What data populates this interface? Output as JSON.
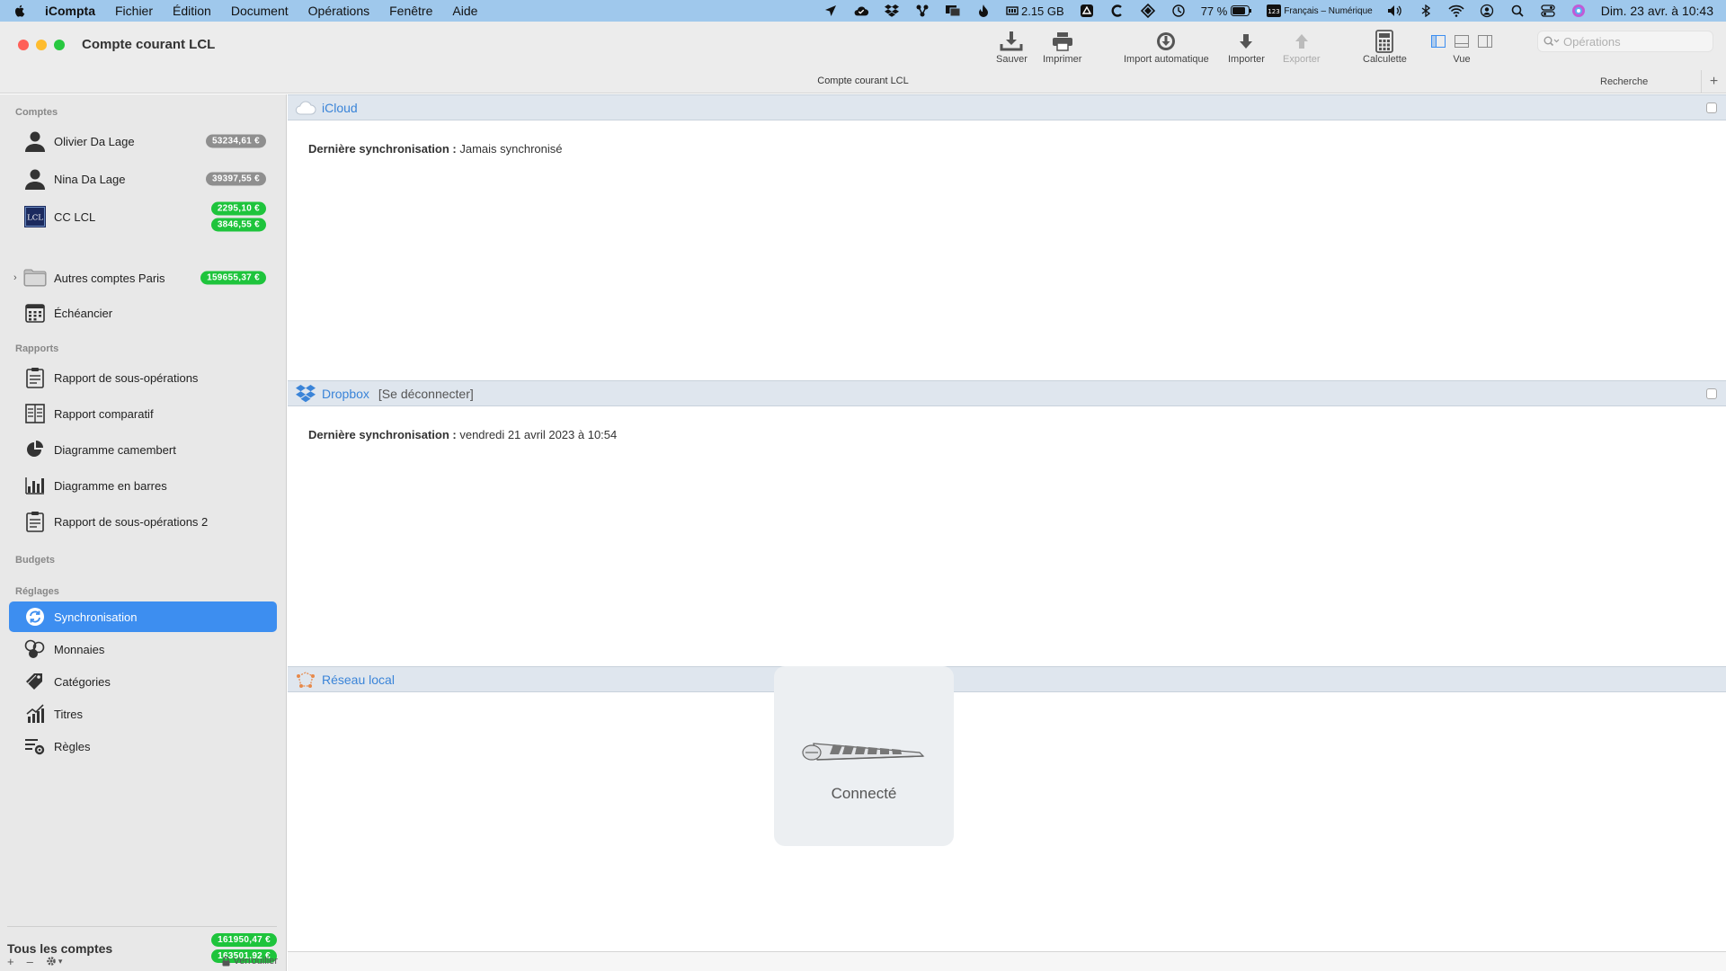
{
  "menubar": {
    "app_name": "iCompta",
    "menus": [
      "Fichier",
      "Édition",
      "Document",
      "Opérations",
      "Fenêtre",
      "Aide"
    ],
    "status": {
      "memory": "2.15 GB",
      "battery": "77 %",
      "input_source": "Français – Numérique",
      "datetime": "Dim. 23 avr. à  10:43"
    }
  },
  "window": {
    "title": "Compte courant LCL",
    "subtitle": "Compte courant LCL"
  },
  "toolbar": {
    "save": "Sauver",
    "print": "Imprimer",
    "auto_import": "Import automatique",
    "import": "Importer",
    "export": "Exporter",
    "calculator": "Calculette",
    "view": "Vue",
    "search_placeholder": "Opérations",
    "search_label": "Recherche"
  },
  "sidebar": {
    "sections": {
      "accounts": "Comptes",
      "reports": "Rapports",
      "budgets": "Budgets",
      "settings": "Réglages"
    },
    "accounts": [
      {
        "label": "Olivier Da Lage",
        "badges": [
          {
            "text": "53234,61 €",
            "color": "grey"
          }
        ]
      },
      {
        "label": "Nina Da Lage",
        "badges": [
          {
            "text": "39397,55 €",
            "color": "grey"
          }
        ]
      },
      {
        "label": "CC LCL",
        "badges": [
          {
            "text": "2295,10 €",
            "color": "green"
          },
          {
            "text": "3846,55 €",
            "color": "green"
          }
        ]
      },
      {
        "label": "Autres comptes Paris",
        "badges": [
          {
            "text": "159655,37 €",
            "color": "green"
          }
        ]
      },
      {
        "label": "Échéancier",
        "badges": []
      }
    ],
    "reports": [
      "Rapport de sous-opérations",
      "Rapport comparatif",
      "Diagramme camembert",
      "Diagramme en barres",
      "Rapport de sous-opérations 2"
    ],
    "settings": [
      "Synchronisation",
      "Monnaies",
      "Catégories",
      "Titres",
      "Règles"
    ],
    "all_accounts": {
      "label": "Tous les comptes",
      "badge1": "161950,47 €",
      "badge2": "163501,92 €"
    },
    "footer": {
      "lock": "Verrouiller"
    }
  },
  "main": {
    "icloud": {
      "title": "iCloud",
      "sync_label": "Dernière synchronisation :",
      "sync_value": "Jamais synchronisé"
    },
    "dropbox": {
      "title": "Dropbox",
      "disconnect": "[Se déconnecter]",
      "sync_label": "Dernière synchronisation :",
      "sync_value": "vendredi 21 avril 2023 à 10:54"
    },
    "local_network": {
      "title": "Réseau local"
    },
    "hud": {
      "label": "Connecté"
    }
  },
  "colors": {
    "accent": "#3d8ef0",
    "badge_green": "#1ec43c",
    "badge_grey": "#8f8f8f",
    "link_blue": "#3a84d8"
  }
}
